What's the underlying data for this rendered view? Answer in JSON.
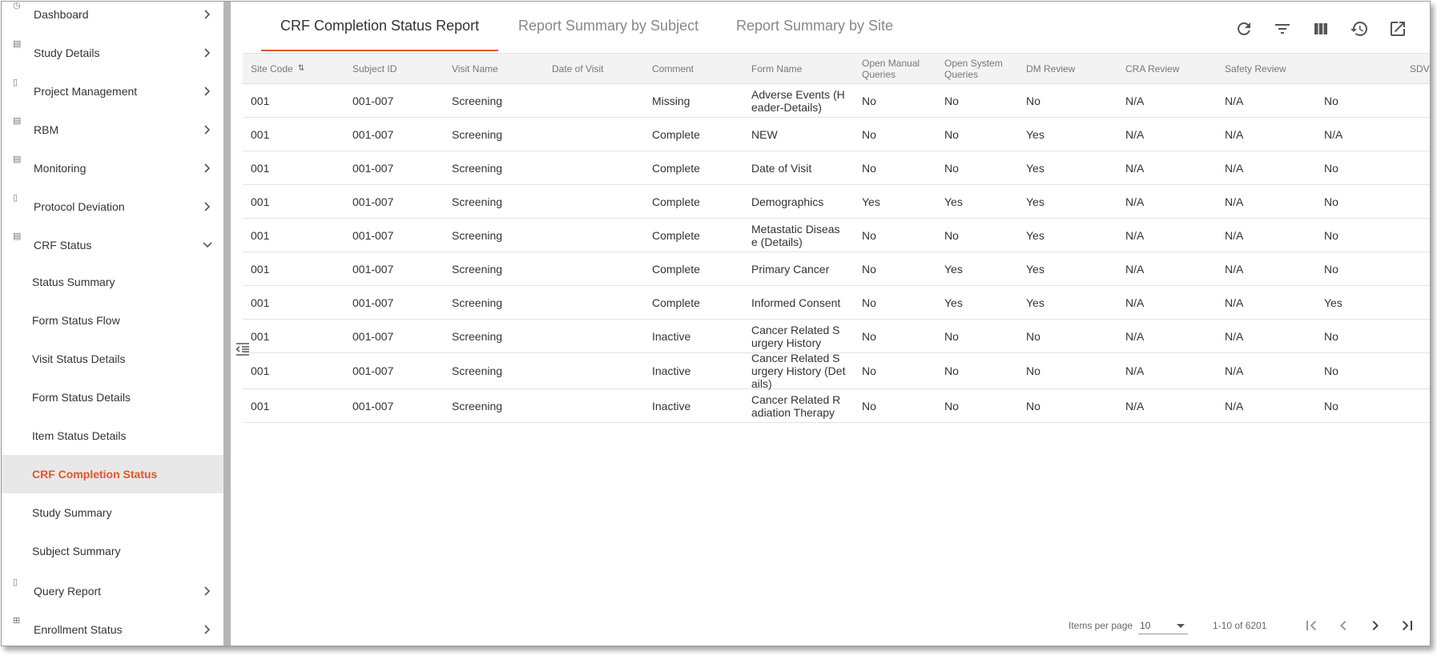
{
  "sidebar": {
    "items": [
      {
        "label": "Dashboard",
        "icon": "dashboard-icon"
      },
      {
        "label": "Study Details",
        "icon": "study-details-icon"
      },
      {
        "label": "Project Management",
        "icon": "project-management-icon"
      },
      {
        "label": "RBM",
        "icon": "rbm-icon"
      },
      {
        "label": "Monitoring",
        "icon": "monitoring-icon"
      },
      {
        "label": "Protocol Deviation",
        "icon": "protocol-deviation-icon"
      },
      {
        "label": "CRF Status",
        "icon": "crf-status-icon",
        "expanded": true
      }
    ],
    "crf_sub_items": [
      {
        "label": "Status Summary"
      },
      {
        "label": "Form Status Flow"
      },
      {
        "label": "Visit Status Details"
      },
      {
        "label": "Form Status Details"
      },
      {
        "label": "Item Status Details"
      },
      {
        "label": "CRF Completion Status",
        "active": true
      },
      {
        "label": "Study Summary"
      },
      {
        "label": "Subject Summary"
      }
    ],
    "bottom_items": [
      {
        "label": "Query Report",
        "icon": "query-report-icon"
      },
      {
        "label": "Enrollment Status",
        "icon": "enrollment-status-icon"
      }
    ]
  },
  "tabs": [
    {
      "label": "CRF Completion Status Report",
      "active": true
    },
    {
      "label": "Report Summary by Subject"
    },
    {
      "label": "Report Summary by Site"
    }
  ],
  "toolbar": [
    "refresh-icon",
    "filter-icon",
    "columns-icon",
    "history-icon",
    "open-external-icon"
  ],
  "table": {
    "headers": {
      "site_code": "Site Code",
      "subject_id": "Subject ID",
      "visit_name": "Visit Name",
      "date_of_visit": "Date of Visit",
      "comment": "Comment",
      "form_name": "Form Name",
      "open_manual_queries": "Open Manual Queries",
      "open_system_queries": "Open System Queries",
      "dm_review": "DM Review",
      "cra_review": "CRA Review",
      "safety_review": "Safety Review",
      "sdv": "SDV"
    },
    "rows": [
      {
        "site": "001",
        "subject": "001-007",
        "visit": "Screening",
        "date": "",
        "comment": "Missing",
        "form": "Adverse Events (Header-Details)",
        "manual": "No",
        "system": "No",
        "dm": "No",
        "cra": "N/A",
        "safety": "N/A",
        "sdv": "No"
      },
      {
        "site": "001",
        "subject": "001-007",
        "visit": "Screening",
        "date": "",
        "comment": "Complete",
        "form": "NEW",
        "manual": "No",
        "system": "No",
        "dm": "Yes",
        "cra": "N/A",
        "safety": "N/A",
        "sdv": "N/A"
      },
      {
        "site": "001",
        "subject": "001-007",
        "visit": "Screening",
        "date": "",
        "comment": "Complete",
        "form": "Date of Visit",
        "manual": "No",
        "system": "No",
        "dm": "Yes",
        "cra": "N/A",
        "safety": "N/A",
        "sdv": "No"
      },
      {
        "site": "001",
        "subject": "001-007",
        "visit": "Screening",
        "date": "",
        "comment": "Complete",
        "form": "Demographics",
        "manual": "Yes",
        "system": "Yes",
        "dm": "Yes",
        "cra": "N/A",
        "safety": "N/A",
        "sdv": "No"
      },
      {
        "site": "001",
        "subject": "001-007",
        "visit": "Screening",
        "date": "",
        "comment": "Complete",
        "form": "Metastatic Disease (Details)",
        "manual": "No",
        "system": "No",
        "dm": "Yes",
        "cra": "N/A",
        "safety": "N/A",
        "sdv": "No"
      },
      {
        "site": "001",
        "subject": "001-007",
        "visit": "Screening",
        "date": "",
        "comment": "Complete",
        "form": "Primary Cancer",
        "manual": "No",
        "system": "Yes",
        "dm": "Yes",
        "cra": "N/A",
        "safety": "N/A",
        "sdv": "No"
      },
      {
        "site": "001",
        "subject": "001-007",
        "visit": "Screening",
        "date": "",
        "comment": "Complete",
        "form": "Informed Consent",
        "manual": "No",
        "system": "Yes",
        "dm": "Yes",
        "cra": "N/A",
        "safety": "N/A",
        "sdv": "Yes"
      },
      {
        "site": "001",
        "subject": "001-007",
        "visit": "Screening",
        "date": "",
        "comment": "Inactive",
        "form": "Cancer Related Surgery History",
        "manual": "No",
        "system": "No",
        "dm": "No",
        "cra": "N/A",
        "safety": "N/A",
        "sdv": "No"
      },
      {
        "site": "001",
        "subject": "001-007",
        "visit": "Screening",
        "date": "",
        "comment": "Inactive",
        "form": "Cancer Related Surgery History (Details)",
        "manual": "No",
        "system": "No",
        "dm": "No",
        "cra": "N/A",
        "safety": "N/A",
        "sdv": "No"
      },
      {
        "site": "001",
        "subject": "001-007",
        "visit": "Screening",
        "date": "",
        "comment": "Inactive",
        "form": "Cancer Related Radiation Therapy",
        "manual": "No",
        "system": "No",
        "dm": "No",
        "cra": "N/A",
        "safety": "N/A",
        "sdv": "No"
      }
    ]
  },
  "paginator": {
    "items_per_page_label": "Items per page",
    "page_size": "10",
    "range_label": "1-10 of 6201"
  },
  "colors": {
    "accent": "#e8532a",
    "active_bg": "#e8e8e8",
    "header_bg": "#f3f3f3"
  }
}
